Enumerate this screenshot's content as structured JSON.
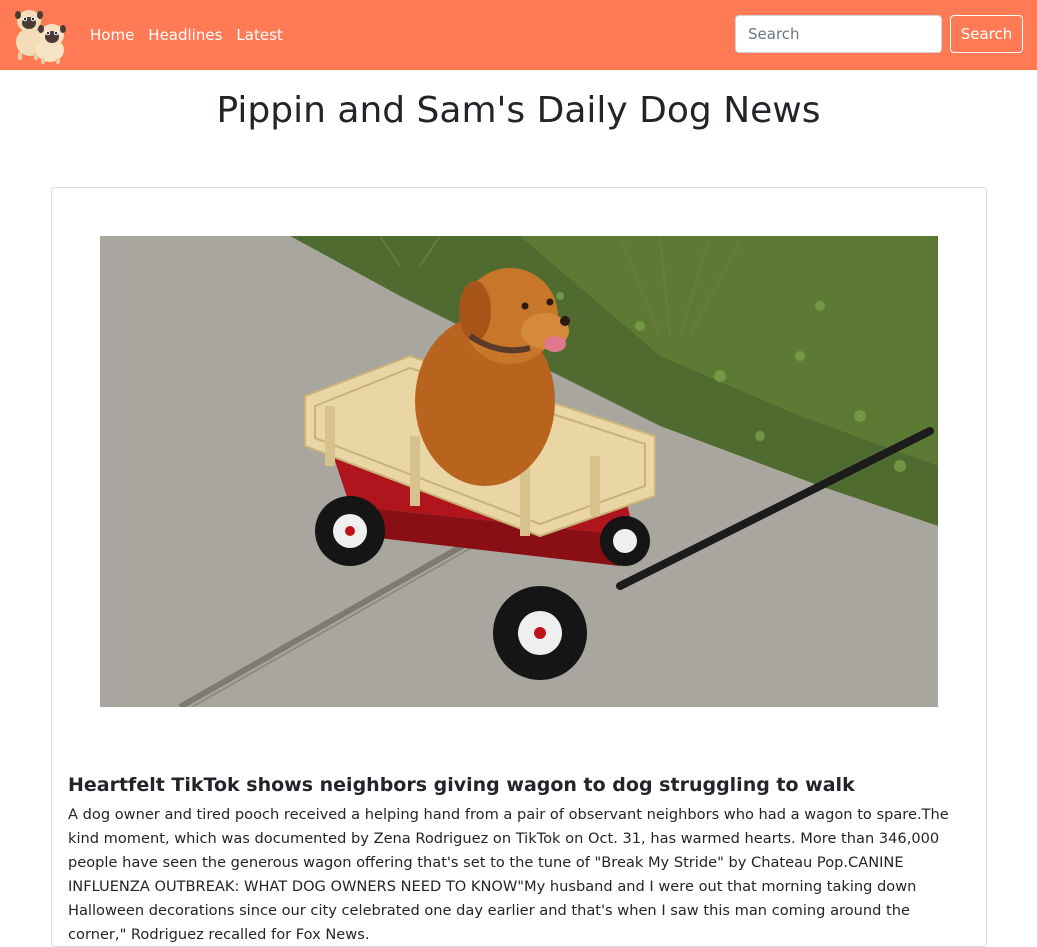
{
  "navbar": {
    "brand_icon": "pug-dogs-logo",
    "links": [
      {
        "label": "Home"
      },
      {
        "label": "Headlines"
      },
      {
        "label": "Latest"
      }
    ],
    "search": {
      "placeholder": "Search",
      "value": "",
      "button_label": "Search"
    },
    "colors": {
      "background": "#ff7a55",
      "text": "#ffffff"
    }
  },
  "page": {
    "title": "Pippin and Sam's Daily Dog News"
  },
  "article": {
    "image_description_icon": "golden-retriever-in-red-wagon-photo",
    "headline": "Heartfelt TikTok shows neighbors giving wagon to dog struggling to walk",
    "body": "A dog owner and tired pooch received a helping hand from a pair of observant neighbors who had a wagon to spare.The kind moment, which was documented by Zena Rodriguez on TikTok on Oct. 31, has warmed hearts. More than 346,000 people have seen the generous wagon offering that's set to the tune of \"Break My Stride\" by Chateau Pop.CANINE INFLUENZA OUTBREAK: WHAT DOG OWNERS NEED TO KNOW\"My husband and I were out that morning taking down Halloween decorations since our city celebrated one day earlier and that's when I saw this man coming around the corner,\" Rodriguez recalled for Fox News."
  }
}
